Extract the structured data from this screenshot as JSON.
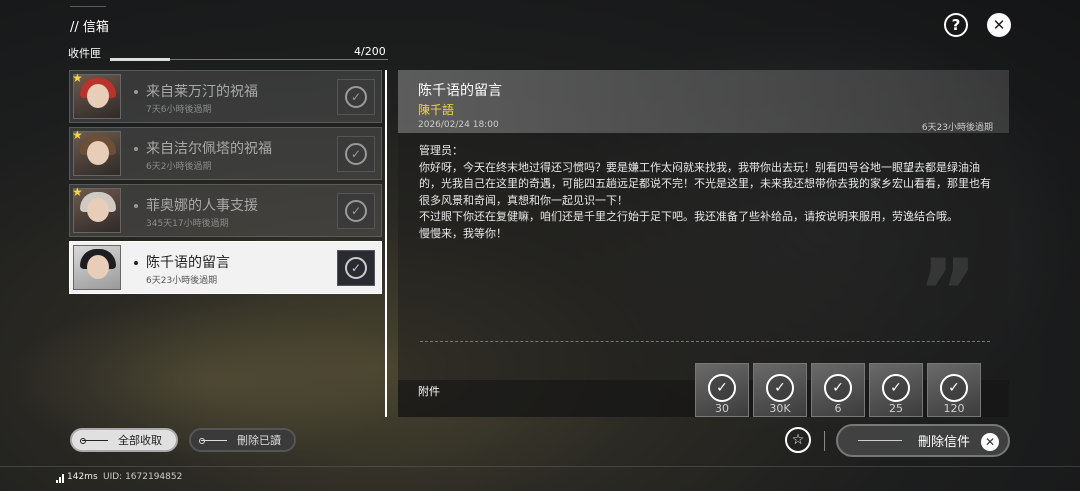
{
  "header": {
    "title": "// 信箱",
    "help_icon": "help-icon",
    "close_icon": "close-icon"
  },
  "inbox": {
    "label": "收件匣",
    "count": "4/200"
  },
  "mail_list": [
    {
      "title": "来自莱万汀的祝福",
      "expiry": "7天6小時後過期",
      "starred": true,
      "hair": "#b8332c"
    },
    {
      "title": "来自洁尔佩塔的祝福",
      "expiry": "6天2小時後過期",
      "starred": true,
      "hair": "#6d4f38"
    },
    {
      "title": "菲奥娜的人事支援",
      "expiry": "345天17小時後過期",
      "starred": true,
      "hair": "#cfcac2"
    },
    {
      "title": "陈千语的留言",
      "expiry": "6天23小時後過期",
      "starred": false,
      "hair": "#1e1e22"
    }
  ],
  "detail": {
    "title": "陈千语的留言",
    "sender": "陳千語",
    "date": "2026/02/24 18:00",
    "expiry": "6天23小時後過期",
    "body": "管理员：\n你好呀，今天在终末地过得还习惯吗？要是嫌工作太闷就来找我，我带你出去玩！别看四号谷地一眼望去都是绿油油的，光我自己在这里的奇遇，可能四五趟远足都说不完！不光是这里，未来我还想带你去我的家乡宏山看看，那里也有很多风景和奇闻，真想和你一起见识一下！\n不过眼下你还在复健嘛，咱们还是千里之行始于足下吧。我还准备了些补给品，请按说明来服用，劳逸结合哦。\n慢慢来，我等你！",
    "attachments_label": "附件",
    "attachments": [
      {
        "qty": "30"
      },
      {
        "qty": "30K"
      },
      {
        "qty": "6"
      },
      {
        "qty": "25"
      },
      {
        "qty": "120"
      }
    ]
  },
  "buttons": {
    "collect_all": "全部收取",
    "delete_read": "刪除已讀",
    "delete_mail": "刪除信件"
  },
  "footer": {
    "ping": "142ms",
    "uid": "UID: 1672194852"
  },
  "colors": {
    "accent_yellow": "#f0d640",
    "selected_bg": "#f2f2f2"
  }
}
